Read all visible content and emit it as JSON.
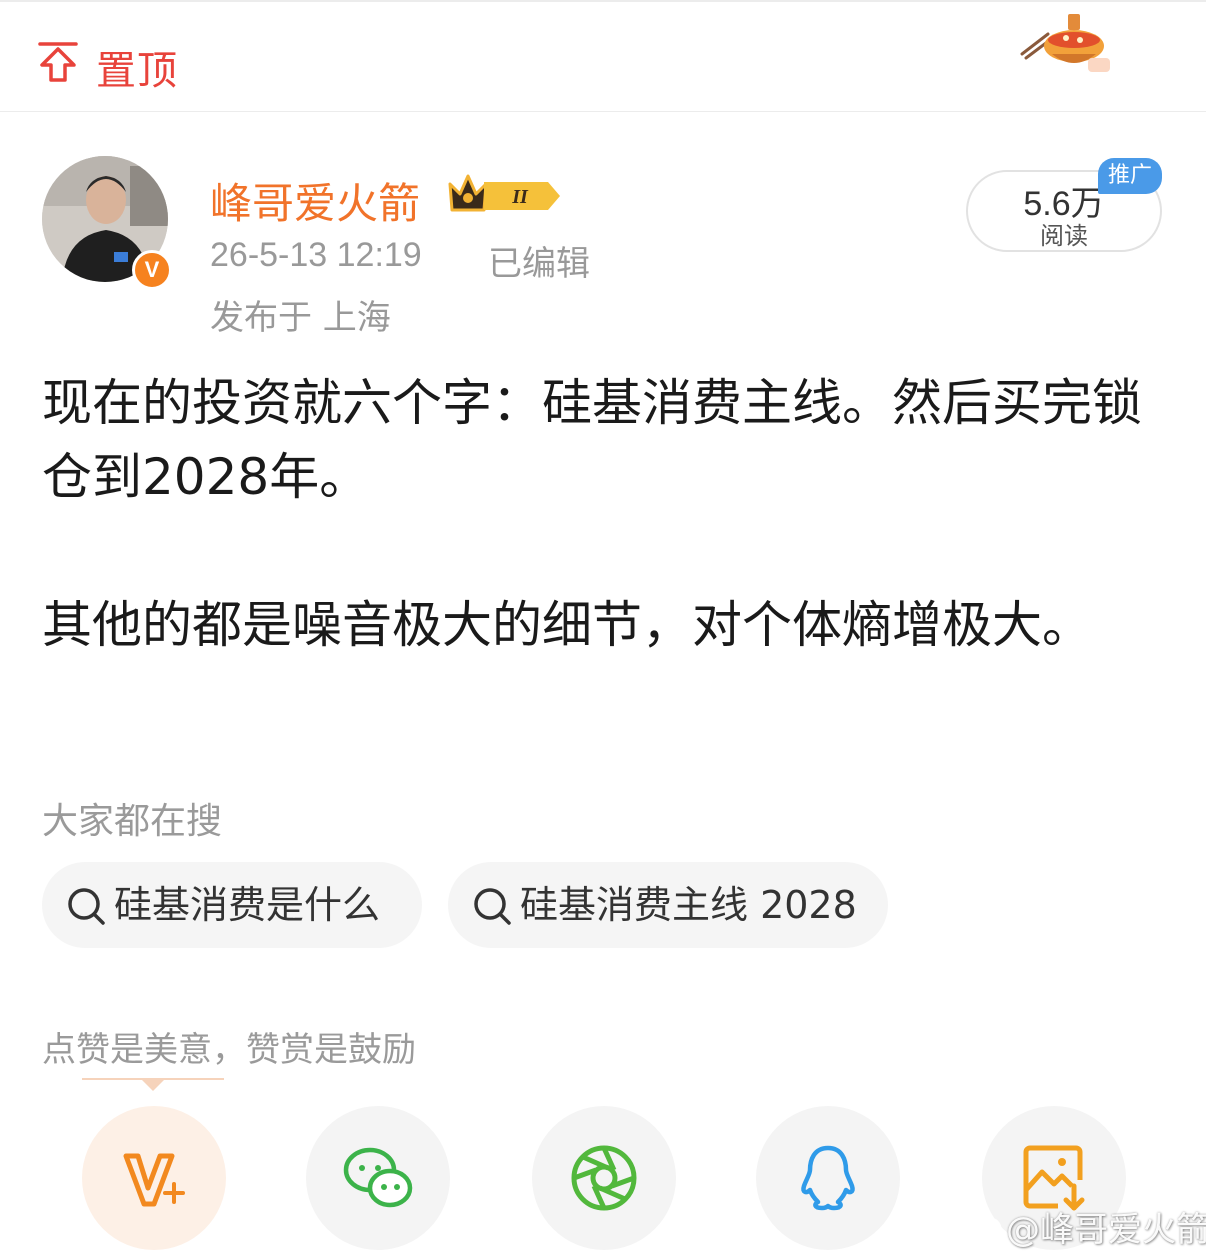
{
  "topbar": {
    "pin_label": "置顶",
    "pin_icon": "pin-to-top-icon",
    "decoration_icon": "hotpot-icon",
    "accent_color": "#e8433b"
  },
  "author": {
    "name": "峰哥爱火箭",
    "name_color": "#f1732a",
    "verified_badge": "V",
    "vip_badge_text": "II",
    "post_time": "26-5-13 12:19",
    "edited_label": "已编辑",
    "location": "发布于 上海"
  },
  "stats": {
    "read_count": "5.6万",
    "read_label": "阅读",
    "promo_badge": "推广"
  },
  "post": {
    "text": "现在的投资就六个字：硅基消费主线。然后买完锁仓到2028年。\n\n其他的都是噪音极大的细节，对个体熵增极大。"
  },
  "search": {
    "heading": "大家都在搜",
    "chips": [
      {
        "label": "硅基消费是什么"
      },
      {
        "label": "硅基消费主线 2028"
      }
    ]
  },
  "reward": {
    "tip": "点赞是美意，赞赏是鼓励"
  },
  "share": {
    "items": [
      {
        "name": "reward",
        "icon": "v-plus-icon"
      },
      {
        "name": "wechat",
        "icon": "wechat-icon"
      },
      {
        "name": "moments",
        "icon": "moments-icon"
      },
      {
        "name": "qq",
        "icon": "qq-icon"
      },
      {
        "name": "save-image",
        "icon": "save-image-icon"
      }
    ]
  },
  "watermark": {
    "text": "@峰哥爱火箭"
  }
}
